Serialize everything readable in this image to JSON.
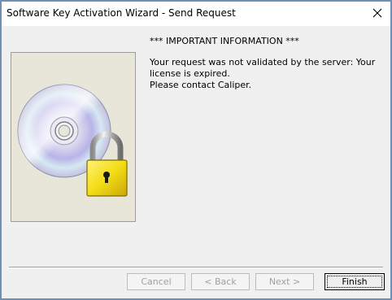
{
  "window": {
    "title": "Software Key Activation Wizard - Send Request"
  },
  "info": {
    "heading": "*** IMPORTANT INFORMATION ***",
    "message_line1": "Your request was not validated by the server: Your",
    "message_line2": "license is expired.",
    "message_line3": "Please contact Caliper."
  },
  "buttons": {
    "cancel": "Cancel",
    "back": "< Back",
    "next": "Next >",
    "finish": "Finish"
  },
  "icons": {
    "close": "close-icon",
    "illustration": "cd-padlock-icon"
  },
  "colors": {
    "window_border": "#6f8fb4",
    "panel_bg": "#e8e6d9",
    "disabled_text": "#a0a0a0",
    "lock_gold": "#f3dc16"
  },
  "state": {
    "cancel_enabled": false,
    "back_enabled": false,
    "next_enabled": false,
    "finish_enabled": true
  }
}
